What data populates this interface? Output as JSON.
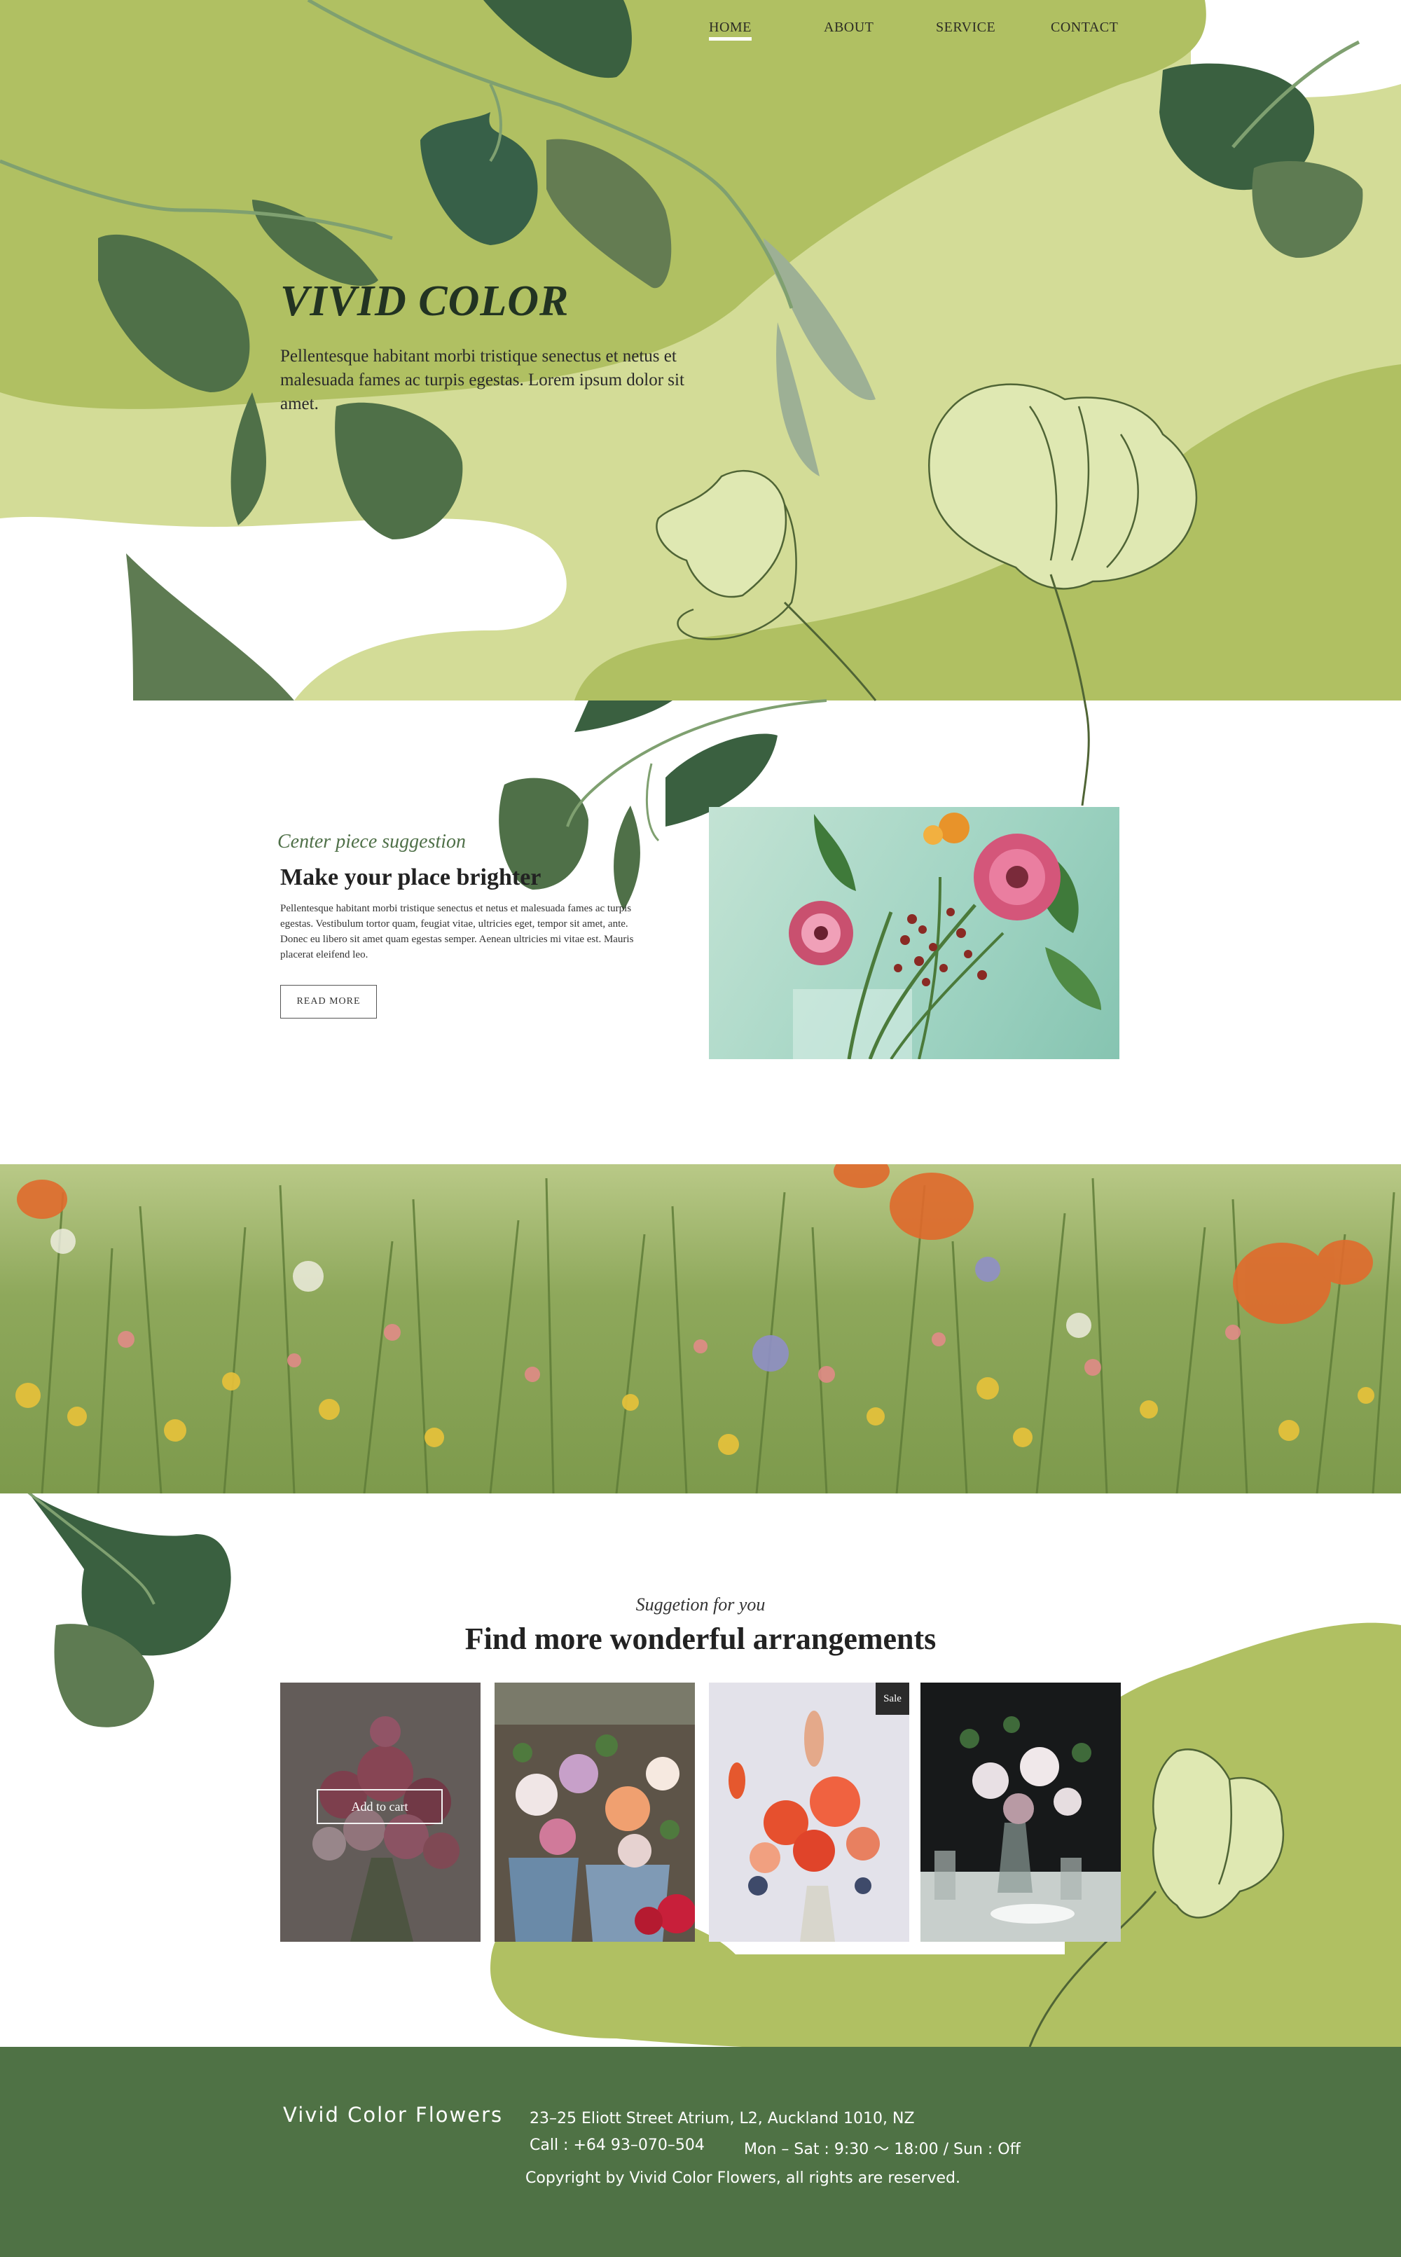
{
  "nav": {
    "items": [
      {
        "label": "HOME",
        "active": true
      },
      {
        "label": "ABOUT",
        "active": false
      },
      {
        "label": "SERVICE",
        "active": false
      },
      {
        "label": "CONTACT",
        "active": false
      }
    ]
  },
  "hero": {
    "title": "VIVID COLOR",
    "text": "Pellentesque habitant morbi tristique senectus et netus et malesuada fames ac turpis egestas. Lorem ipsum dolor sit amet."
  },
  "centerpiece": {
    "eyebrow": "Center piece suggestion",
    "title": "Make your place brighter",
    "text": "Pellentesque habitant morbi tristique senectus et netus et malesuada fames ac turpis egestas. Vestibulum tortor quam, feugiat vitae, ultricies eget, tempor sit amet, ante. Donec eu libero sit amet quam egestas semper. Aenean ultricies mi vitae est. Mauris placerat eleifend leo.",
    "button": "READ MORE"
  },
  "suggestion": {
    "eyebrow": "Suggetion for you",
    "title": "Find more wonderful arrangements",
    "cart_label": "Add to cart",
    "sale_badge": "Sale"
  },
  "footer": {
    "brand": "Vivid Color Flowers",
    "address": "23–25 Eliott Street Atrium, L2, Auckland 1010, NZ",
    "phone": "Call : +64 93–070–504",
    "hours": "Mon – Sat : 9:30 〜 18:00 / Sun : Off",
    "copyright": "Copyright by Vivid Color Flowers, all rights are reserved."
  },
  "colors": {
    "lime": "#b0c062",
    "pale_lime": "#d3dc97",
    "dark_leaf": "#3a6040",
    "mid_leaf": "#5e7b52",
    "footer_green": "#4f7245",
    "text_dark": "#222222"
  }
}
